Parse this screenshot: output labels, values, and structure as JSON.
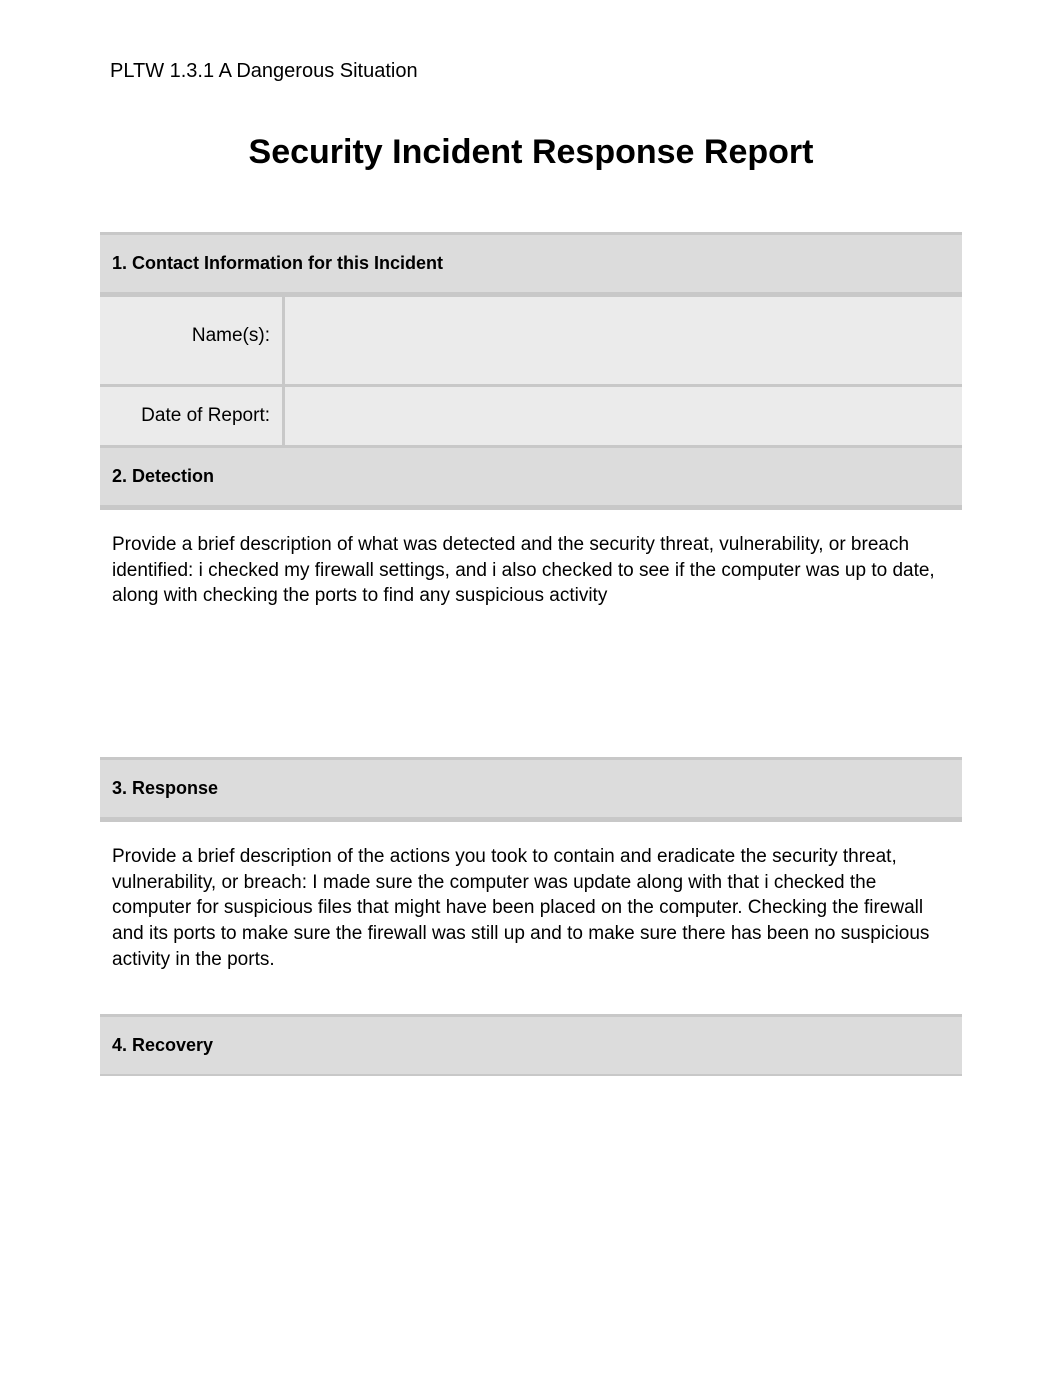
{
  "header": "PLTW 1.3.1 A Dangerous Situation",
  "title": "Security Incident Response Report",
  "sections": {
    "contact": {
      "heading": "1. Contact Information for this Incident",
      "fields": {
        "names_label": "Name(s):",
        "names_value": "",
        "date_label": "Date of Report:",
        "date_value": ""
      }
    },
    "detection": {
      "heading": "2.  Detection",
      "content": "Provide a brief description of what was detected and the security threat, vulnerability, or breach identified: i checked my firewall settings, and i also checked to see if the computer was up to date, along with checking the ports to find any suspicious activity"
    },
    "response": {
      "heading": "3. Response",
      "content": "Provide a brief description of the actions you took to contain and eradicate the security threat, vulnerability, or breach: I made sure the computer was update along with that i checked the computer for suspicious files that might have been placed on the computer. Checking the firewall and its ports to make sure the firewall was still up and to make sure there has been no suspicious activity in the ports."
    },
    "recovery": {
      "heading": "4. Recovery"
    }
  }
}
